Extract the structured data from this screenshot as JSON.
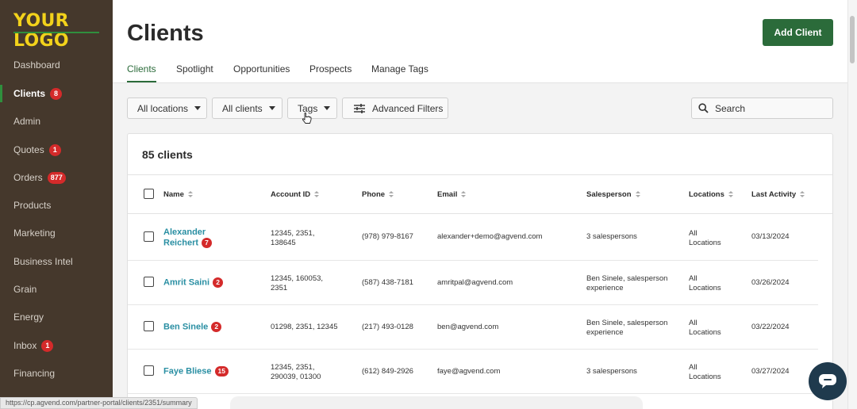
{
  "app": {
    "logo_text": "YOUR LOGO",
    "colors": {
      "sidebar": "#45382c",
      "logo": "#f2d21b",
      "accent": "#2b6b3a",
      "link": "#2a8fa3",
      "badge": "#d42a2a"
    }
  },
  "sidebar": {
    "items": [
      {
        "label": "Dashboard",
        "badge": ""
      },
      {
        "label": "Clients",
        "badge": "8"
      },
      {
        "label": "Admin",
        "badge": ""
      },
      {
        "label": "Quotes",
        "badge": "1"
      },
      {
        "label": "Orders",
        "badge": "877"
      },
      {
        "label": "Products",
        "badge": ""
      },
      {
        "label": "Marketing",
        "badge": ""
      },
      {
        "label": "Business Intel",
        "badge": ""
      },
      {
        "label": "Grain",
        "badge": ""
      },
      {
        "label": "Energy",
        "badge": ""
      },
      {
        "label": "Inbox",
        "badge": "1"
      },
      {
        "label": "Financing",
        "badge": ""
      }
    ]
  },
  "header": {
    "title": "Clients",
    "add_button": "Add Client",
    "tabs": [
      "Clients",
      "Spotlight",
      "Opportunities",
      "Prospects",
      "Manage Tags"
    ]
  },
  "filters": {
    "locations": "All locations",
    "clients": "All clients",
    "tags": "Tags",
    "advanced": "Advanced Filters",
    "search_placeholder": "Search"
  },
  "table": {
    "count_label": "85 clients",
    "columns": [
      "Name",
      "Account ID",
      "Phone",
      "Email",
      "Salesperson",
      "Locations",
      "Last Activity"
    ],
    "rows": [
      {
        "name_line1": "Alexander",
        "name_line2": "Reichert",
        "badge": "7",
        "account_line1": "12345, 2351,",
        "account_line2": "138645",
        "phone": "(978) 979-8167",
        "email": "alexander+demo@agvend.com",
        "sales_line1": "3 salespersons",
        "sales_line2": "",
        "loc_line1": "All",
        "loc_line2": "Locations",
        "activity": "03/13/2024"
      },
      {
        "name_line1": "Amrit Saini",
        "name_line2": "",
        "badge": "2",
        "account_line1": "12345, 160053,",
        "account_line2": "2351",
        "phone": "(587) 438-7181",
        "email": "amritpal@agvend.com",
        "sales_line1": "Ben Sinele, salesperson",
        "sales_line2": "experience",
        "loc_line1": "All",
        "loc_line2": "Locations",
        "activity": "03/26/2024"
      },
      {
        "name_line1": "Ben Sinele",
        "name_line2": "",
        "badge": "2",
        "account_line1": "01298, 2351, 12345",
        "account_line2": "",
        "phone": "(217) 493-0128",
        "email": "ben@agvend.com",
        "sales_line1": "Ben Sinele, salesperson",
        "sales_line2": "experience",
        "loc_line1": "All",
        "loc_line2": "Locations",
        "activity": "03/22/2024"
      },
      {
        "name_line1": "Faye Bliese",
        "name_line2": "",
        "badge": "15",
        "account_line1": "12345, 2351,",
        "account_line2": "290039, 01300",
        "phone": "(612) 849-2926",
        "email": "faye@agvend.com",
        "sales_line1": "3 salespersons",
        "sales_line2": "",
        "loc_line1": "All",
        "loc_line2": "Locations",
        "activity": "03/27/2024"
      }
    ]
  },
  "footer": {
    "status_url": "https://cp.agvend.com/partner-portal/clients/2351/summary"
  }
}
